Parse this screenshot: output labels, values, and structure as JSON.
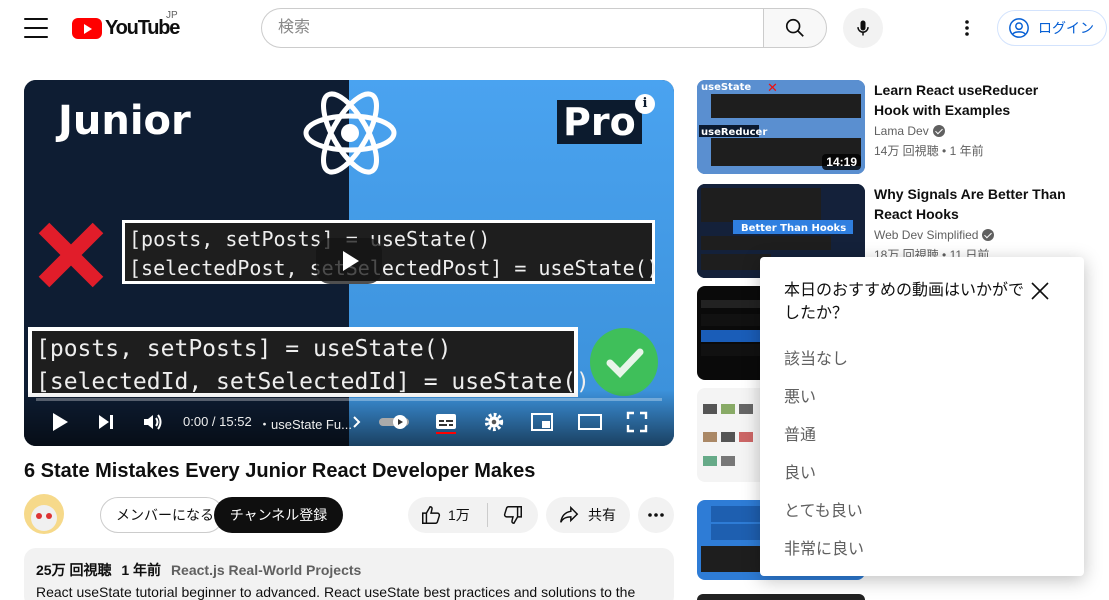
{
  "header": {
    "logo_text": "YouTube",
    "region": "JP",
    "search_placeholder": "検索",
    "signin_label": "ログイン"
  },
  "player": {
    "thumbnail": {
      "left_text": "Junior",
      "right_text": "Pro",
      "code_top": [
        "[posts, setPosts] = useState()",
        "[selectedPost, setSelectedPost] = useState()"
      ],
      "code_bottom": [
        "[posts, setPosts] = useState()",
        "[selectedId, setSelectedId] = useState()"
      ]
    },
    "time": "0:00 / 15:52",
    "chapter": "・useState Fu...",
    "progress": 0
  },
  "video": {
    "title": "6 State Mistakes Every Junior React Developer Makes",
    "member_label": "メンバーになる",
    "subscribe_label": "チャンネル登録",
    "likes": "1万",
    "share_label": "共有",
    "description": {
      "views": "25万 回視聴",
      "age": "1 年前",
      "tags": "React.js Real-World Projects",
      "text": "React useState tutorial beginner to advanced. React useState best practices and solutions to the"
    }
  },
  "recommendations": [
    {
      "title": "Learn React useReducer Hook with Examples",
      "channel": "Lama Dev",
      "views": "14万 回視聴",
      "age": "1 年前",
      "duration": "14:19"
    },
    {
      "title": "Why Signals Are Better Than React Hooks",
      "channel": "Web Dev Simplified",
      "views": "18万 回視聴",
      "age": "11 日前",
      "duration": ""
    }
  ],
  "survey": {
    "question": "本日のおすすめの動画はいかがでしたか？",
    "options": [
      "該当なし",
      "悪い",
      "普通",
      "良い",
      "とても良い",
      "非常に良い"
    ]
  },
  "colors": {
    "brand_red": "#ff0000",
    "link_blue": "#065fd4"
  }
}
